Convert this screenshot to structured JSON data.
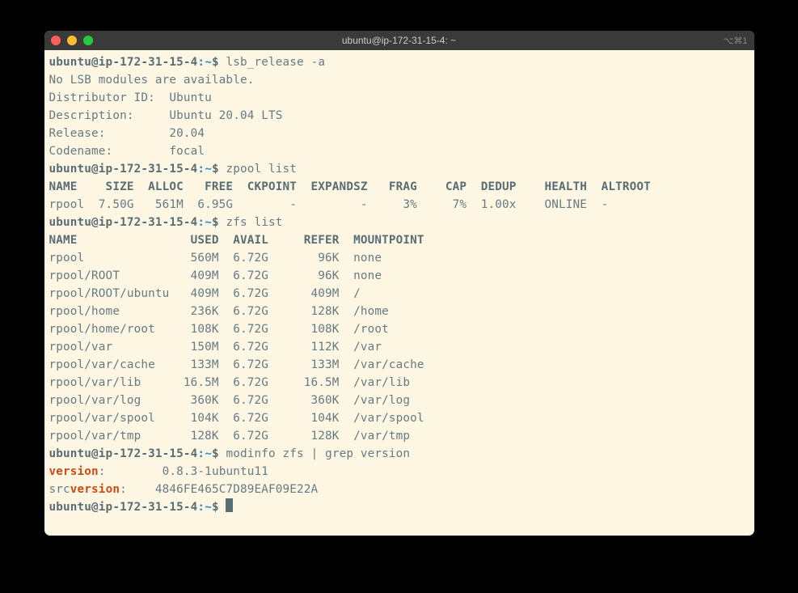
{
  "window": {
    "title": "ubuntu@ip-172-31-15-4: ~",
    "shortcut_hint": "⌥⌘1"
  },
  "prompt": {
    "user_host": "ubuntu@ip-172-31-15-4",
    "colon": ":",
    "path": "~",
    "symbol": "$"
  },
  "commands": {
    "lsb": "lsb_release -a",
    "zpool": "zpool list",
    "zfs": "zfs list",
    "modinfo": "modinfo zfs | grep version"
  },
  "lsb_output": {
    "no_modules": "No LSB modules are available.",
    "distributor_line": "Distributor ID:\tUbuntu",
    "description_line": "Description:\tUbuntu 20.04 LTS",
    "release_line": "Release:\t20.04",
    "codename_line": "Codename:\tfocal"
  },
  "zpool_header": "NAME    SIZE  ALLOC   FREE  CKPOINT  EXPANDSZ   FRAG    CAP  DEDUP    HEALTH  ALTROOT",
  "zpool_row": "rpool  7.50G   561M  6.95G        -         -     3%     7%  1.00x    ONLINE  -",
  "zfs_header": "NAME                USED  AVAIL     REFER  MOUNTPOINT",
  "zfs_rows": [
    "rpool               560M  6.72G       96K  none",
    "rpool/ROOT          409M  6.72G       96K  none",
    "rpool/ROOT/ubuntu   409M  6.72G      409M  /",
    "rpool/home          236K  6.72G      128K  /home",
    "rpool/home/root     108K  6.72G      108K  /root",
    "rpool/var           150M  6.72G      112K  /var",
    "rpool/var/cache     133M  6.72G      133M  /var/cache",
    "rpool/var/lib      16.5M  6.72G     16.5M  /var/lib",
    "rpool/var/log       360K  6.72G      360K  /var/log",
    "rpool/var/spool     104K  6.72G      104K  /var/spool",
    "rpool/var/tmp       128K  6.72G      128K  /var/tmp"
  ],
  "modinfo": {
    "version_label": "version",
    "version_colon": ":",
    "version_pad": "        ",
    "version_value": "0.8.3-1ubuntu11",
    "src_prefix": "src",
    "src_pad": "    ",
    "src_value": "4846FE465C7D89EAF09E22A"
  }
}
